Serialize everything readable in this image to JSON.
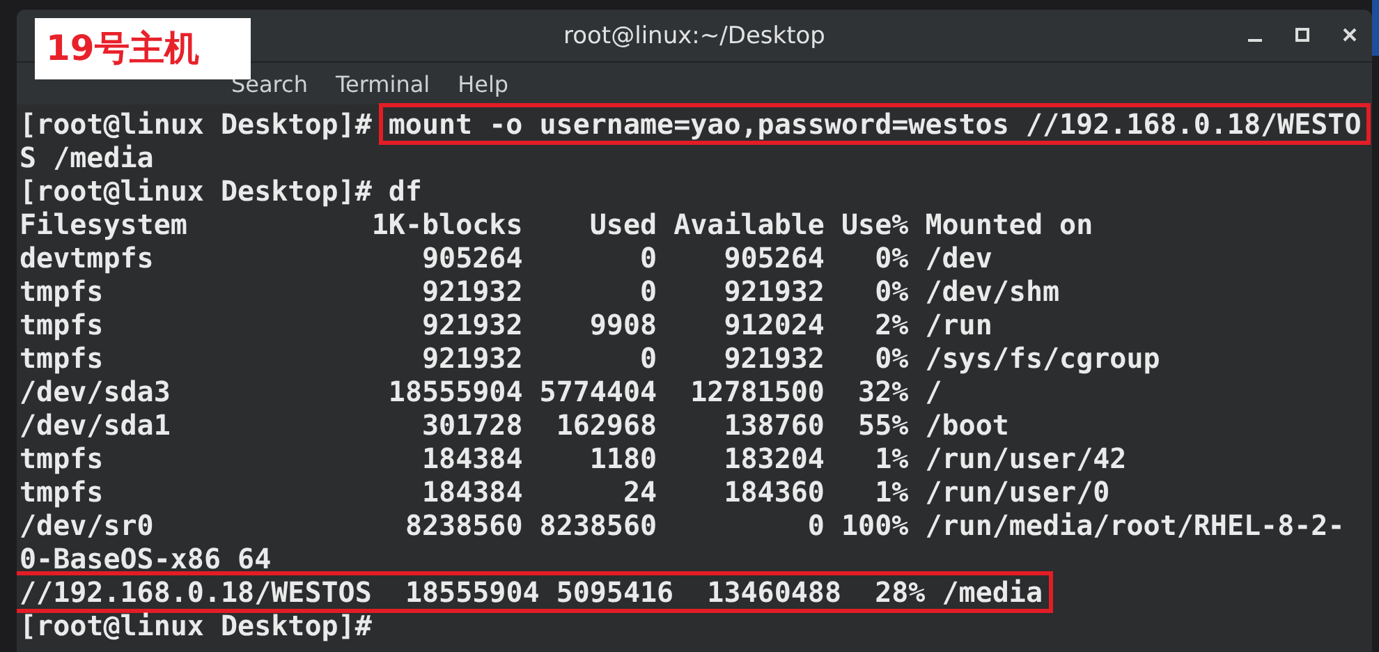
{
  "label": "19号主机",
  "window": {
    "title": "root@linux:~/Desktop"
  },
  "menu": [
    "Search",
    "Terminal",
    "Help"
  ],
  "lines": [
    {
      "prompt": "[root@linux Desktop]#",
      "text": "mount -o username=yao,password=westos //192.168.0.18/WESTO",
      "boxed": true
    },
    {
      "text": "S /media",
      "boxed": false
    },
    {
      "prompt": "[root@linux Desktop]#",
      "text": "df",
      "boxed": false
    },
    {
      "text": "Filesystem           1K-blocks    Used Available Use% Mounted on",
      "boxed": false
    },
    {
      "text": "devtmpfs                905264       0    905264   0% /dev",
      "boxed": false
    },
    {
      "text": "tmpfs                   921932       0    921932   0% /dev/shm",
      "boxed": false
    },
    {
      "text": "tmpfs                   921932    9908    912024   2% /run",
      "boxed": false
    },
    {
      "text": "tmpfs                   921932       0    921932   0% /sys/fs/cgroup",
      "boxed": false
    },
    {
      "text": "/dev/sda3             18555904 5774404  12781500  32% /",
      "boxed": false
    },
    {
      "text": "/dev/sda1               301728  162968    138760  55% /boot",
      "boxed": false
    },
    {
      "text": "tmpfs                   184384    1180    183204   1% /run/user/42",
      "boxed": false
    },
    {
      "text": "tmpfs                   184384      24    184360   1% /run/user/0",
      "boxed": false
    },
    {
      "text": "/dev/sr0               8238560 8238560         0 100% /run/media/root/RHEL-8-2-",
      "boxed": false
    },
    {
      "text": "0-BaseOS-x86 64",
      "boxed": false
    },
    {
      "text": "//192.168.0.18/WESTOS  18555904 5095416  13460488  28% /media",
      "boxed": true
    },
    {
      "prompt": "[root@linux Desktop]#",
      "boxed": false
    }
  ]
}
